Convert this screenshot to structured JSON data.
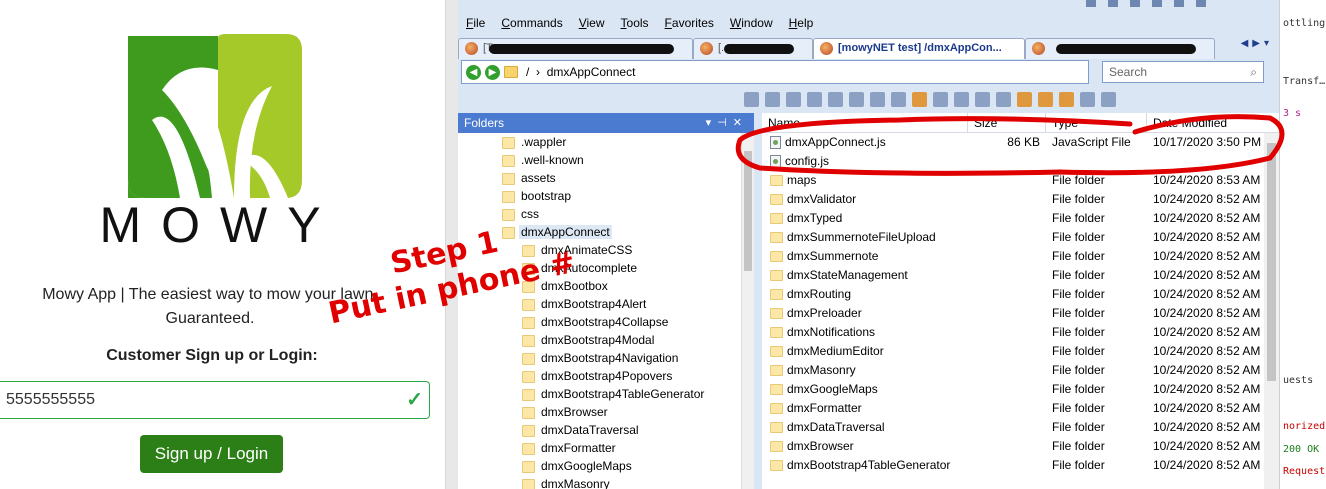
{
  "app": {
    "brand": "MOWY",
    "tagline_line1": "Mowy App | The easiest way to mow your lawn.",
    "tagline_line2": "Guaranteed.",
    "signup_heading": "Customer Sign up or Login:",
    "phone_value": "5555555555",
    "login_button": "Sign up / Login",
    "colors": {
      "primary_green": "#2c7e17",
      "logo_dark": "#3e9b1d",
      "logo_light": "#a6c92a",
      "valid": "#28a745"
    }
  },
  "annotation": {
    "line1": "Step 1",
    "line2": "Put in phone #",
    "color": "#e00000"
  },
  "ftp": {
    "menu": [
      "File",
      "Commands",
      "View",
      "Tools",
      "Favorites",
      "Window",
      "Help"
    ],
    "tabs": [
      {
        "label": "[T...",
        "redacted": true,
        "active": false
      },
      {
        "label": "[...",
        "redacted": true,
        "active": false
      },
      {
        "label": "[mowyNET test] /dmxAppCon...",
        "redacted": false,
        "active": true
      },
      {
        "label": "",
        "redacted": true,
        "active": false
      }
    ],
    "address": {
      "root": "/",
      "current": "dmxAppConnect"
    },
    "search_placeholder": "Search",
    "folders_title": "Folders",
    "tree": [
      {
        "label": ".wappler",
        "level": 1
      },
      {
        "label": ".well-known",
        "level": 1
      },
      {
        "label": "assets",
        "level": 1
      },
      {
        "label": "bootstrap",
        "level": 1
      },
      {
        "label": "css",
        "level": 1
      },
      {
        "label": "dmxAppConnect",
        "level": 1,
        "selected": true
      },
      {
        "label": "dmxAnimateCSS",
        "level": 2
      },
      {
        "label": "dmxAutocomplete",
        "level": 2
      },
      {
        "label": "dmxBootbox",
        "level": 2
      },
      {
        "label": "dmxBootstrap4Alert",
        "level": 2
      },
      {
        "label": "dmxBootstrap4Collapse",
        "level": 2
      },
      {
        "label": "dmxBootstrap4Modal",
        "level": 2
      },
      {
        "label": "dmxBootstrap4Navigation",
        "level": 2
      },
      {
        "label": "dmxBootstrap4Popovers",
        "level": 2
      },
      {
        "label": "dmxBootstrap4TableGenerator",
        "level": 2
      },
      {
        "label": "dmxBrowser",
        "level": 2
      },
      {
        "label": "dmxDataTraversal",
        "level": 2
      },
      {
        "label": "dmxFormatter",
        "level": 2
      },
      {
        "label": "dmxGoogleMaps",
        "level": 2
      },
      {
        "label": "dmxMasonry",
        "level": 2
      }
    ],
    "columns": {
      "name": "Name",
      "size": "Size",
      "type": "Type",
      "date": "Date Modified"
    },
    "files": [
      {
        "name": "dmxAppConnect.js",
        "size": "86 KB",
        "type": "JavaScript File",
        "date": "10/17/2020 3:50 PM",
        "kind": "file"
      },
      {
        "name": "config.js",
        "size": "",
        "type": "",
        "date": "",
        "kind": "file"
      },
      {
        "name": "maps",
        "size": "",
        "type": "File folder",
        "date": "10/24/2020 8:53 AM",
        "kind": "folder"
      },
      {
        "name": "dmxValidator",
        "size": "",
        "type": "File folder",
        "date": "10/24/2020 8:52 AM",
        "kind": "folder"
      },
      {
        "name": "dmxTyped",
        "size": "",
        "type": "File folder",
        "date": "10/24/2020 8:52 AM",
        "kind": "folder"
      },
      {
        "name": "dmxSummernoteFileUpload",
        "size": "",
        "type": "File folder",
        "date": "10/24/2020 8:52 AM",
        "kind": "folder"
      },
      {
        "name": "dmxSummernote",
        "size": "",
        "type": "File folder",
        "date": "10/24/2020 8:52 AM",
        "kind": "folder"
      },
      {
        "name": "dmxStateManagement",
        "size": "",
        "type": "File folder",
        "date": "10/24/2020 8:52 AM",
        "kind": "folder"
      },
      {
        "name": "dmxRouting",
        "size": "",
        "type": "File folder",
        "date": "10/24/2020 8:52 AM",
        "kind": "folder"
      },
      {
        "name": "dmxPreloader",
        "size": "",
        "type": "File folder",
        "date": "10/24/2020 8:52 AM",
        "kind": "folder"
      },
      {
        "name": "dmxNotifications",
        "size": "",
        "type": "File folder",
        "date": "10/24/2020 8:52 AM",
        "kind": "folder"
      },
      {
        "name": "dmxMediumEditor",
        "size": "",
        "type": "File folder",
        "date": "10/24/2020 8:52 AM",
        "kind": "folder"
      },
      {
        "name": "dmxMasonry",
        "size": "",
        "type": "File folder",
        "date": "10/24/2020 8:52 AM",
        "kind": "folder"
      },
      {
        "name": "dmxGoogleMaps",
        "size": "",
        "type": "File folder",
        "date": "10/24/2020 8:52 AM",
        "kind": "folder"
      },
      {
        "name": "dmxFormatter",
        "size": "",
        "type": "File folder",
        "date": "10/24/2020 8:52 AM",
        "kind": "folder"
      },
      {
        "name": "dmxDataTraversal",
        "size": "",
        "type": "File folder",
        "date": "10/24/2020 8:52 AM",
        "kind": "folder"
      },
      {
        "name": "dmxBrowser",
        "size": "",
        "type": "File folder",
        "date": "10/24/2020 8:52 AM",
        "kind": "folder"
      },
      {
        "name": "dmxBootstrap4TableGenerator",
        "size": "",
        "type": "File folder",
        "date": "10/24/2020 8:52 AM",
        "kind": "folder"
      }
    ]
  },
  "devtools": {
    "lines": [
      {
        "text": "ottling",
        "color": "#333"
      },
      {
        "text": "Transf…",
        "color": "#333"
      },
      {
        "text": "3 s",
        "color": "#b1258e"
      },
      {
        "text": "uests",
        "color": "#333"
      },
      {
        "text": "norized",
        "color": "#c80000"
      },
      {
        "text": "200 OK",
        "color": "#1a7f1a"
      },
      {
        "text": "Request",
        "color": "#c80000"
      }
    ]
  }
}
